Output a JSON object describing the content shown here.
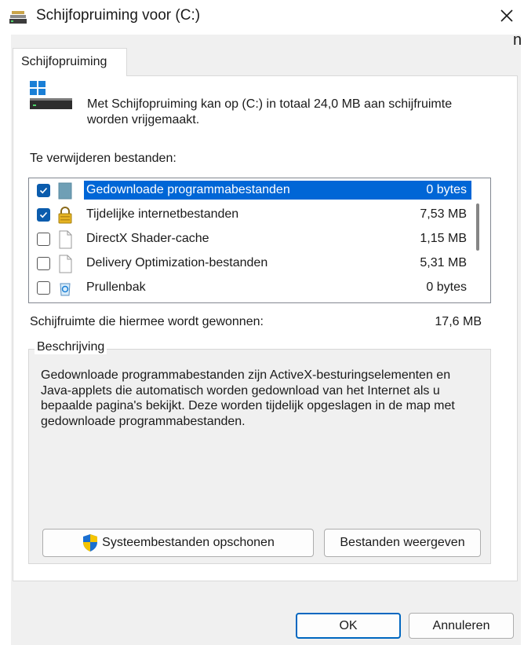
{
  "window": {
    "title": "Schijfopruiming voor  (C:)",
    "close_icon": "close-icon",
    "stray_text": "n"
  },
  "tabs": [
    {
      "label": "Schijfopruiming",
      "active": true
    }
  ],
  "intro": {
    "text": "Met Schijfopruiming kan op  (C:) in totaal 24,0 MB aan schijfruimte worden vrijgemaakt.",
    "icon": "drive-icon"
  },
  "files": {
    "label": "Te verwijderen bestanden:",
    "items": [
      {
        "name": "Gedownloade programmabestanden",
        "size": "0 bytes",
        "checked": true,
        "selected": true,
        "icon": "folder-icon"
      },
      {
        "name": "Tijdelijke internetbestanden",
        "size": "7,53 MB",
        "checked": true,
        "selected": false,
        "icon": "lock-icon"
      },
      {
        "name": "DirectX Shader-cache",
        "size": "1,15 MB",
        "checked": false,
        "selected": false,
        "icon": "file-icon"
      },
      {
        "name": "Delivery Optimization-bestanden",
        "size": "5,31 MB",
        "checked": false,
        "selected": false,
        "icon": "file-icon"
      },
      {
        "name": "Prullenbak",
        "size": "0 bytes",
        "checked": false,
        "selected": false,
        "icon": "recycle-bin-icon"
      }
    ]
  },
  "gain": {
    "label": "Schijfruimte die hiermee wordt gewonnen:",
    "value": "17,6 MB"
  },
  "description": {
    "legend": "Beschrijving",
    "text": "Gedownloade programmabestanden zijn ActiveX-besturingselementen en Java-applets die automatisch worden gedownload van het Internet als u bepaalde pagina's bekijkt. Deze worden tijdelijk opgeslagen in de map met gedownloade programmabestanden."
  },
  "buttons": {
    "clean_system": "Systeembestanden opschonen",
    "view_files": "Bestanden weergeven",
    "ok": "OK",
    "cancel": "Annuleren"
  },
  "colors": {
    "selection": "#0066d6",
    "checkbox": "#0b5cad",
    "dialog_bg": "#f0f0f0",
    "ok_border": "#0067c0"
  }
}
